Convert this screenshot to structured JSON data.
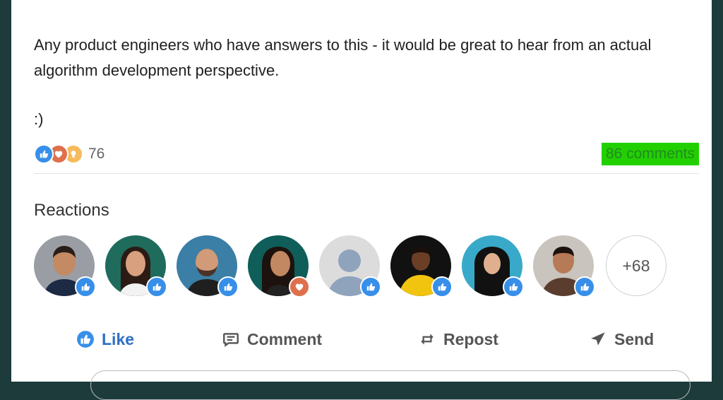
{
  "post": {
    "text": "Any product engineers who have answers to this - it would be great to hear from an actual algorithm development perspective.",
    "smile": ":)"
  },
  "stats": {
    "reaction_icons": [
      "like-icon",
      "love-icon",
      "insightful-icon"
    ],
    "reaction_count": "76",
    "comments_label": "86 comments",
    "comments_highlight_color": "#22d000"
  },
  "reactions": {
    "heading": "Reactions",
    "people": [
      {
        "reaction": "like",
        "bg": "#8a8f98"
      },
      {
        "reaction": "like",
        "bg": "#1f6b5c"
      },
      {
        "reaction": "like",
        "bg": "#3b7ea6"
      },
      {
        "reaction": "love",
        "bg": "#0f5e5a"
      },
      {
        "reaction": "like",
        "bg": "#dcdcdc",
        "placeholder": true
      },
      {
        "reaction": "like",
        "bg": "#111111"
      },
      {
        "reaction": "like",
        "bg": "#39a9c9"
      },
      {
        "reaction": "like",
        "bg": "#c9c4bd"
      }
    ],
    "more_label": "+68"
  },
  "actions": {
    "like": "Like",
    "comment": "Comment",
    "repost": "Repost",
    "send": "Send"
  },
  "colors": {
    "like_blue": "#378fe9",
    "love_red": "#df704d",
    "insight_gold": "#f5bb5c"
  }
}
